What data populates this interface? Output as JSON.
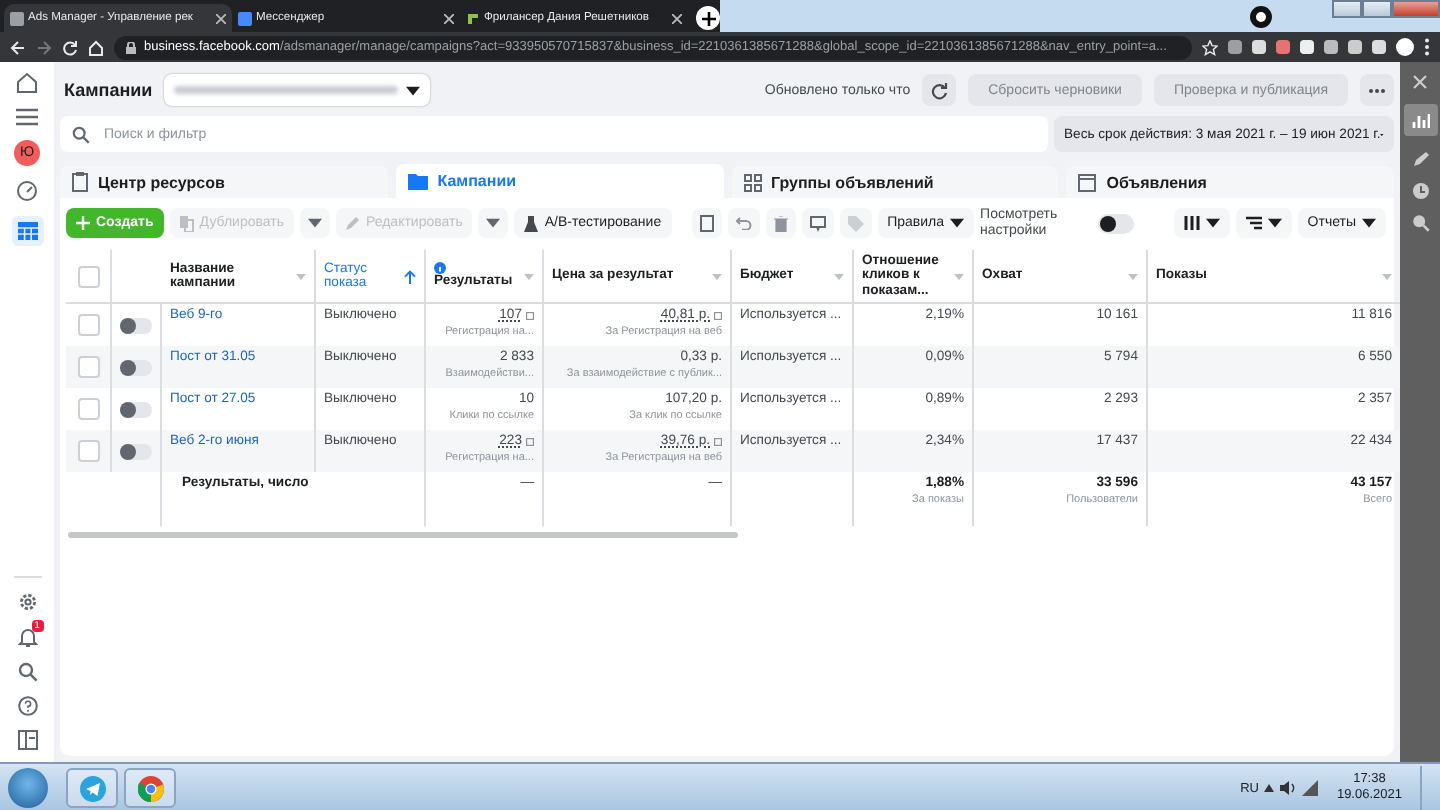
{
  "browser": {
    "tabs": [
      {
        "title": "Ads Manager - Управление рек",
        "selected": true
      },
      {
        "title": "Мессенджер",
        "selected": false
      },
      {
        "title": "Фрилансер Дания Решетников",
        "selected": false
      }
    ],
    "url_host": "business.facebook.com",
    "url_path": "/adsmanager/manage/campaigns?act=933950570715837&business_id=2210361385671288&global_scope_id=2210361385671288&nav_entry_point=a..."
  },
  "sidebar": {
    "avatar": "Ю",
    "notification_badge": "1"
  },
  "header": {
    "title": "Кампании",
    "status": "Обновлено только что",
    "buttons": [
      {
        "label": "Сбросить черновики",
        "disabled": true
      },
      {
        "label": "Проверка и публикация",
        "disabled": true
      }
    ]
  },
  "search": {
    "placeholder": "Поиск и фильтр"
  },
  "date_range": "Весь срок действия: 3 мая 2021 г. – 19 июн 2021 г.",
  "level_tabs": [
    {
      "label": "Центр ресурсов",
      "kind": "resources",
      "selected": false
    },
    {
      "label": "Кампании",
      "kind": "campaigns",
      "selected": true
    },
    {
      "label": "Группы объявлений",
      "kind": "adsets",
      "selected": false
    },
    {
      "label": "Объявления",
      "kind": "ads",
      "selected": false
    }
  ],
  "toolbar": {
    "create": "Создать",
    "duplicate": {
      "label": "Дублировать",
      "disabled": true
    },
    "edit": {
      "label": "Редактировать",
      "disabled": true
    },
    "ab_test": "A/B-тестирование",
    "rules": "Правила",
    "view_settings": "Посмотреть настройки",
    "view_settings_on": false,
    "reports": "Отчеты"
  },
  "table": {
    "all_checked": false,
    "columns": [
      {
        "label": "Название кампании",
        "sorted": false,
        "info": false
      },
      {
        "label": "Статус показа",
        "sorted": true,
        "info": false
      },
      {
        "label": "Результаты",
        "sorted": false,
        "info": true
      },
      {
        "label": "Цена за результат",
        "sorted": false,
        "info": false
      },
      {
        "label": "Бюджет",
        "sorted": false,
        "info": false
      },
      {
        "label": "Отношение кликов к показам...",
        "sorted": false,
        "info": false
      },
      {
        "label": "Охват",
        "sorted": false,
        "info": false
      },
      {
        "label": "Показы",
        "sorted": false,
        "info": false
      }
    ],
    "rows": [
      {
        "name": "Веб 9-го",
        "checked": false,
        "on": false,
        "delivery": "Выключено",
        "results": "107",
        "results_sub": "Регистрация на...",
        "price": "40,81 р.",
        "price_sub": "За Регистрация на веб",
        "estimated": true,
        "budget": "Используется ...",
        "ctr": "2,19%",
        "reach": "10 161",
        "impressions": "11 816"
      },
      {
        "name": "Пост от 31.05",
        "checked": false,
        "on": false,
        "delivery": "Выключено",
        "results": "2 833",
        "results_sub": "Взаимодействи...",
        "price": "0,33 р.",
        "price_sub": "За взаимодействие с публик...",
        "estimated": false,
        "budget": "Используется ...",
        "ctr": "0,09%",
        "reach": "5 794",
        "impressions": "6 550"
      },
      {
        "name": "Пост от 27.05",
        "checked": false,
        "on": false,
        "delivery": "Выключено",
        "results": "10",
        "results_sub": "Клики по ссылке",
        "price": "107,20 р.",
        "price_sub": "За клик по ссылке",
        "estimated": false,
        "budget": "Используется ...",
        "ctr": "0,89%",
        "reach": "2 293",
        "impressions": "2 357"
      },
      {
        "name": "Веб 2-го июня",
        "checked": false,
        "on": false,
        "delivery": "Выключено",
        "results": "223",
        "results_sub": "Регистрация на...",
        "price": "39,76 р.",
        "price_sub": "За Регистрация на веб",
        "estimated": true,
        "budget": "Используется ...",
        "ctr": "2,34%",
        "reach": "17 437",
        "impressions": "22 434"
      }
    ],
    "summary": {
      "label": "Результаты, число",
      "results": "—",
      "price": "—",
      "ctr": "1,88%",
      "ctr_sub": "За показы",
      "reach": "33 596",
      "reach_sub": "Пользователи",
      "impressions": "43 157",
      "impressions_sub": "Всего"
    }
  },
  "taskbar": {
    "language": "RU",
    "time": "17:38",
    "date": "19.06.2021"
  }
}
